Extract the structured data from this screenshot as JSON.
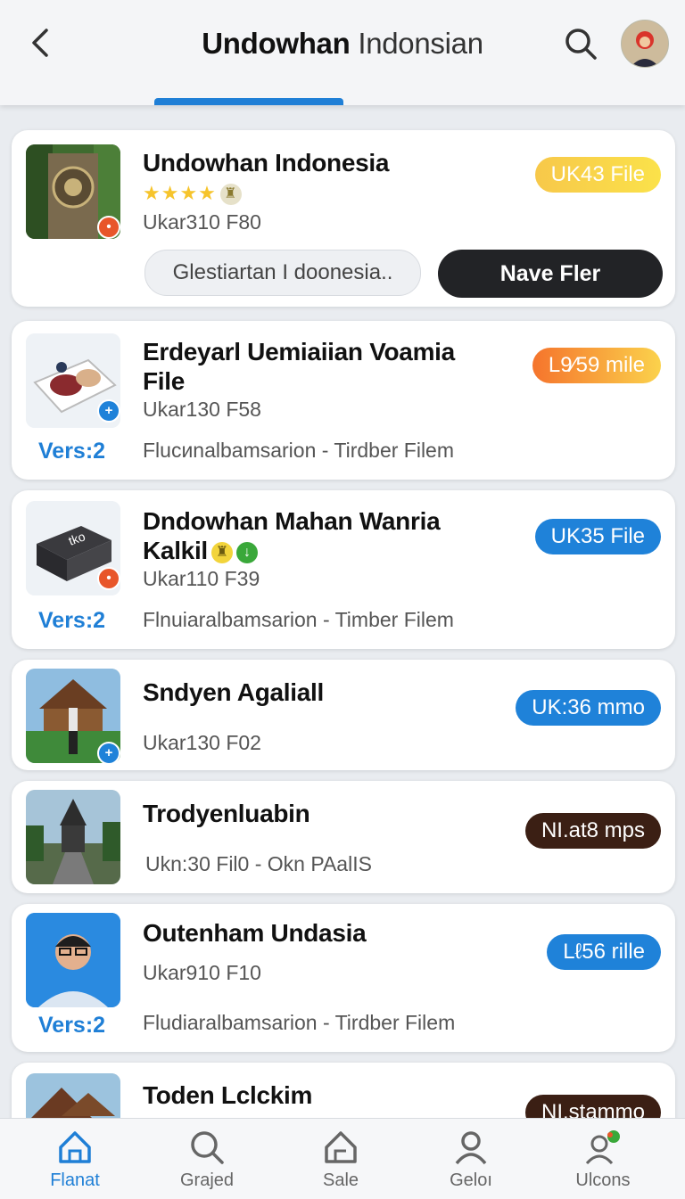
{
  "header": {
    "title_bold": "Undowhan",
    "title_light": " Indonsian"
  },
  "cards": [
    {
      "title": "Undowhan Indonesia",
      "rating_stars": "★★★★",
      "sub": "Ukar310 F80",
      "pill": "UK43 File",
      "secondary_button": "Glestiartan I doonesia..",
      "primary_button": "Nave Fler"
    },
    {
      "title": "Erdeyarl Uemiaiian Voamia File",
      "sub": "Ukar130 F58",
      "vers": "Vers:2",
      "desc": "Flucиnalbamsarion - Tirdber Filem",
      "pill": "L9⁄59 mile"
    },
    {
      "title": "Dndowhan Mahan Wanria Kalkil",
      "sub": "Ukar110 F39",
      "vers": "Vers:2",
      "desc": "Flnuiaralbamsarion - Timber Filem",
      "pill": "UK35 File"
    },
    {
      "title": "Sndyen Agaliall",
      "sub": "Ukar130 F02",
      "pill": "UK:36 mmo"
    },
    {
      "title": "Trodyenluabin",
      "sub": "Ukn:30 Fil0 - Okn PAalIS",
      "pill": "NI.at8 mps"
    },
    {
      "title": "Outenham Undasia",
      "sub": "Ukar910 F10",
      "vers": "Vers:2",
      "desc": "Fludiaralbamsarion - Tirdber Filem",
      "pill": "Lℓ56 rille"
    },
    {
      "title": "Toden Lclckim",
      "pill": "NI.stammo"
    }
  ],
  "nav": [
    {
      "label": "Flanat",
      "icon": "home-icon"
    },
    {
      "label": "Grajed",
      "icon": "search-icon"
    },
    {
      "label": "Sale",
      "icon": "house-outline-icon"
    },
    {
      "label": "Geloı",
      "icon": "user-icon"
    },
    {
      "label": "Ulcons",
      "icon": "users-icon"
    }
  ],
  "colors": {
    "accent": "#1f7fd6",
    "dark_button": "#222326",
    "brown_pill": "#3b1f14"
  }
}
